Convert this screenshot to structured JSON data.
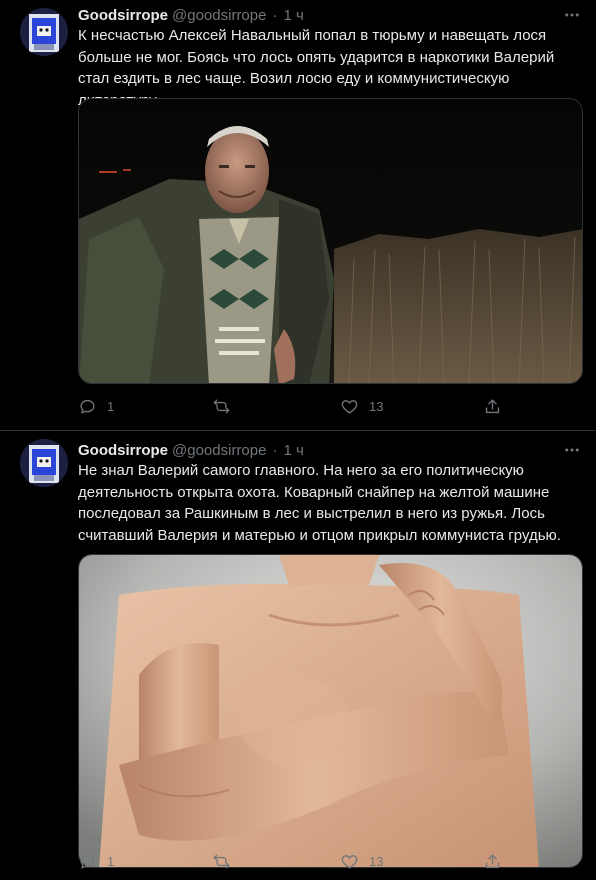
{
  "tweets": [
    {
      "name": "Goodsirrope",
      "handle": "@goodsirrope",
      "separator": "·",
      "time": "1 ч",
      "text": "К несчастью Алексей Навальный попал в тюрьму и навещать лося больше не мог. Боясь что лось опять ударится в наркотики Валерий стал ездить в лес чаще. Возил лосю еду и коммунистическую литературу.",
      "replies": "1",
      "retweets": "",
      "likes": "13"
    },
    {
      "name": "Goodsirrope",
      "handle": "@goodsirrope",
      "separator": "·",
      "time": "1 ч",
      "text": "Не знал Валерий самого главного. На него за его политическую деятельность открыта охота. Коварный снайпер на желтой машине последовал за Рашкиным в лес и выстрелил в него из ружья. Лось считавший Валерия и матерью и отцом прикрыл коммуниста грудью.",
      "replies": "1",
      "retweets": "",
      "likes": "13"
    }
  ],
  "colors": {
    "background": "#000000",
    "text": "#e7e9ea",
    "secondary": "#71767b",
    "border": "#2f3336"
  },
  "icons": [
    "more-icon",
    "reply-icon",
    "retweet-icon",
    "like-icon",
    "share-icon"
  ]
}
